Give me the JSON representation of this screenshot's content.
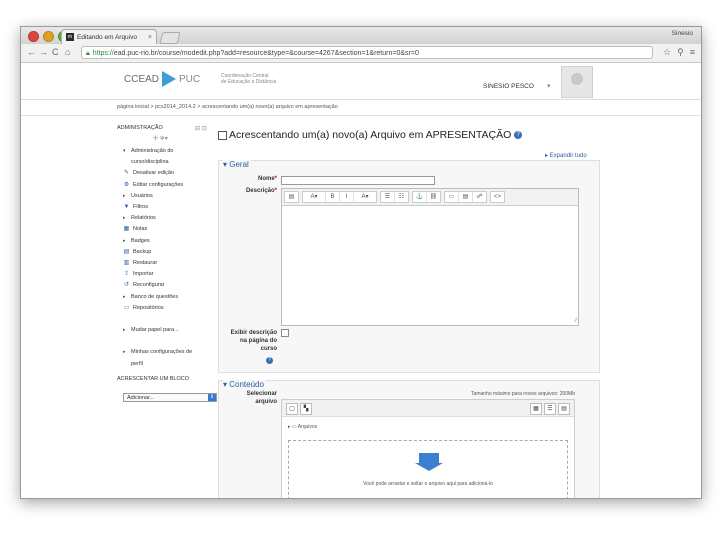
{
  "browser": {
    "tab_title": "Editando em Arquivo",
    "tab_close": "×",
    "profile": "Sinesio",
    "url_scheme": "https://",
    "url_rest": "ead.puc-rio.br/course/modedit.php?add=resource&type=&course=4267&section=1&return=0&sr=0",
    "back": "←",
    "forward": "→",
    "reload": "C",
    "home": "⌂"
  },
  "header": {
    "logo_text": "CCEAD",
    "logo_puc": "PUC",
    "logo_sub_1": "Coordenação Central",
    "logo_sub_2": "de Educação a Distância",
    "user_name": "SINESIO PESCO"
  },
  "breadcrumb": "página inicial  >  pcs2014_2014.2  >  acrescentando um(a) novo(a) arquivo em apresentação",
  "sidebar": {
    "title": "ADMINISTRAÇÃO",
    "title_icons": "⊟ ⊡",
    "move_icons": "✢ ✲▾",
    "items": [
      {
        "label": "Administração do",
        "arrow": "▾"
      },
      {
        "label": "curso/disciplina",
        "arrow": ""
      },
      {
        "label": "Desativar edição",
        "icon": "✎"
      },
      {
        "label": "Editar configurações",
        "icon": "⚙"
      },
      {
        "label": "Usuários",
        "arrow": "▸"
      },
      {
        "label": "Filtros",
        "icon": "▼"
      },
      {
        "label": "Relatórios",
        "arrow": "▸"
      },
      {
        "label": "Notas",
        "icon": "▦"
      },
      {
        "label": "Badges",
        "arrow": "▸"
      },
      {
        "label": "Backup",
        "icon": "▤"
      },
      {
        "label": "Restaurar",
        "icon": "▥"
      },
      {
        "label": "Importar",
        "icon": "⇪"
      },
      {
        "label": "Reconfigurar",
        "icon": "↺"
      },
      {
        "label": "Banco de questões",
        "arrow": "▸"
      },
      {
        "label": "Repositórios",
        "icon": "▭"
      },
      {
        "label": "",
        "arrow": ""
      },
      {
        "label": "Mudar papel para...",
        "arrow": "▸"
      },
      {
        "label": "",
        "arrow": ""
      },
      {
        "label": "Minhas configurações de",
        "arrow": "▸"
      },
      {
        "label": "perfil",
        "arrow": ""
      }
    ],
    "add_block_title": "ACRESCENTAR UM BLOCO",
    "add_select_value": "Adicionar...",
    "add_select_arrow": "⇕"
  },
  "main": {
    "title": "Acrescentando um(a) novo(a) Arquivo em APRESENTAÇÃO",
    "help": "?",
    "expand_all": "▸ Expandir tudo",
    "general_legend": "▾ Geral",
    "name_label": "Nome",
    "description_label": "Descrição",
    "required_mark": "*",
    "show_desc_label_1": "Exibir descrição",
    "show_desc_label_2": "na página do",
    "show_desc_label_3": "curso",
    "toolbar": [
      "▤",
      "A▾",
      "B",
      "I",
      "A▾",
      "☰",
      "☷",
      "⚓",
      "⛓",
      "▭",
      "▤",
      "☍",
      "<>"
    ],
    "resize": "⁄⁄",
    "content_legend": "▾ Conteúdo",
    "select_files_label_1": "Selecionar",
    "select_files_label_2": "arquivo",
    "max_size": "Tamanho máximo para novos arquivos: 200Mb",
    "fp_add": "▢",
    "fp_folder": "▚",
    "fp_views": [
      "▦",
      "☰",
      "▤"
    ],
    "fp_path": "▸ ▭ Arquivos",
    "drop_text": "Você pode arrastar e soltar o arquivo aqui para adicioná-lo"
  }
}
